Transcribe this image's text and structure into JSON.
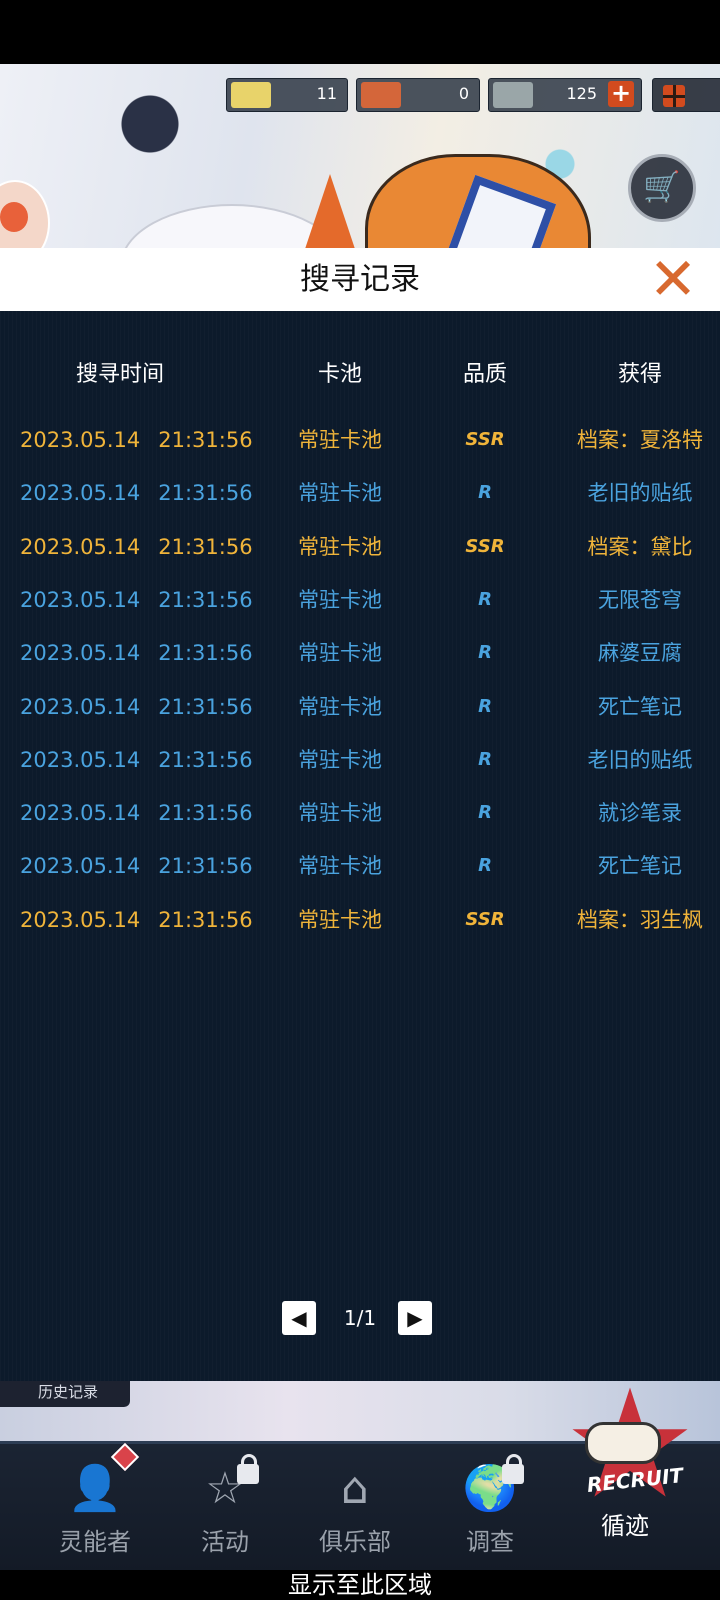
{
  "header": {
    "resources": [
      {
        "icon": "ticket-icon",
        "value": "11"
      },
      {
        "icon": "coin-icon",
        "value": "0"
      },
      {
        "icon": "gem-icon",
        "value": "125"
      }
    ],
    "add_label": "+",
    "shop_icon": "cart-icon"
  },
  "dialog": {
    "title": "搜寻记录",
    "close_label": "✕"
  },
  "table": {
    "columns": [
      "搜寻时间",
      "卡池",
      "品质",
      "获得"
    ],
    "rows": [
      {
        "date": "2023.05.14",
        "time": "21:31:56",
        "pool": "常驻卡池",
        "quality": "SSR",
        "item": "档案：夏洛特",
        "color": "#f0b43a"
      },
      {
        "date": "2023.05.14",
        "time": "21:31:56",
        "pool": "常驻卡池",
        "quality": "R",
        "item": "老旧的贴纸",
        "color": "#4aa3df"
      },
      {
        "date": "2023.05.14",
        "time": "21:31:56",
        "pool": "常驻卡池",
        "quality": "SSR",
        "item": "档案：黛比",
        "color": "#f0b43a"
      },
      {
        "date": "2023.05.14",
        "time": "21:31:56",
        "pool": "常驻卡池",
        "quality": "R",
        "item": "无限苍穹",
        "color": "#4aa3df"
      },
      {
        "date": "2023.05.14",
        "time": "21:31:56",
        "pool": "常驻卡池",
        "quality": "R",
        "item": "麻婆豆腐",
        "color": "#4aa3df"
      },
      {
        "date": "2023.05.14",
        "time": "21:31:56",
        "pool": "常驻卡池",
        "quality": "R",
        "item": "死亡笔记",
        "color": "#4aa3df"
      },
      {
        "date": "2023.05.14",
        "time": "21:31:56",
        "pool": "常驻卡池",
        "quality": "R",
        "item": "老旧的贴纸",
        "color": "#4aa3df"
      },
      {
        "date": "2023.05.14",
        "time": "21:31:56",
        "pool": "常驻卡池",
        "quality": "R",
        "item": "就诊笔录",
        "color": "#4aa3df"
      },
      {
        "date": "2023.05.14",
        "time": "21:31:56",
        "pool": "常驻卡池",
        "quality": "R",
        "item": "死亡笔记",
        "color": "#4aa3df"
      },
      {
        "date": "2023.05.14",
        "time": "21:31:56",
        "pool": "常驻卡池",
        "quality": "SSR",
        "item": "档案：羽生枫",
        "color": "#f0b43a"
      }
    ]
  },
  "pager": {
    "text": "1/1",
    "prev": "◀",
    "next": "▶"
  },
  "history_tab": "历史记录",
  "nav": [
    {
      "label": "灵能者",
      "icon": "person-icon",
      "glyph": "👤",
      "locked": false
    },
    {
      "label": "活动",
      "icon": "star-icon",
      "glyph": "☆",
      "locked": true
    },
    {
      "label": "俱乐部",
      "icon": "home-icon",
      "glyph": "⌂",
      "locked": false
    },
    {
      "label": "调查",
      "icon": "globe-icon",
      "glyph": "🌍",
      "locked": true
    },
    {
      "label": "循迹",
      "icon": "recruit-icon",
      "glyph": "",
      "locked": false
    }
  ],
  "recruit_text": "RECRUIT",
  "bottom_caption": "显示至此区域"
}
